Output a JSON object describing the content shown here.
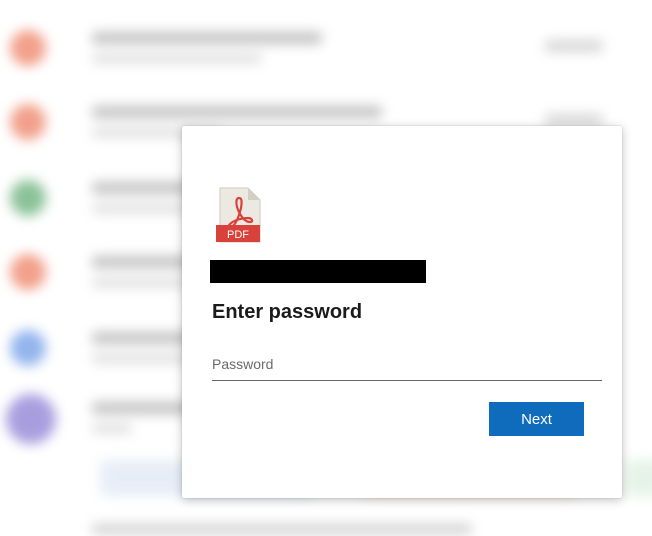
{
  "dialog": {
    "file_icon_label": "PDF",
    "file_icon_name": "pdf-file-icon",
    "title": "Enter password",
    "password_placeholder": "Password",
    "password_value": "",
    "next_label": "Next"
  },
  "colors": {
    "accent": "#0f6cbd",
    "pdf_red": "#d9423a",
    "pdf_page": "#ece9e2"
  }
}
